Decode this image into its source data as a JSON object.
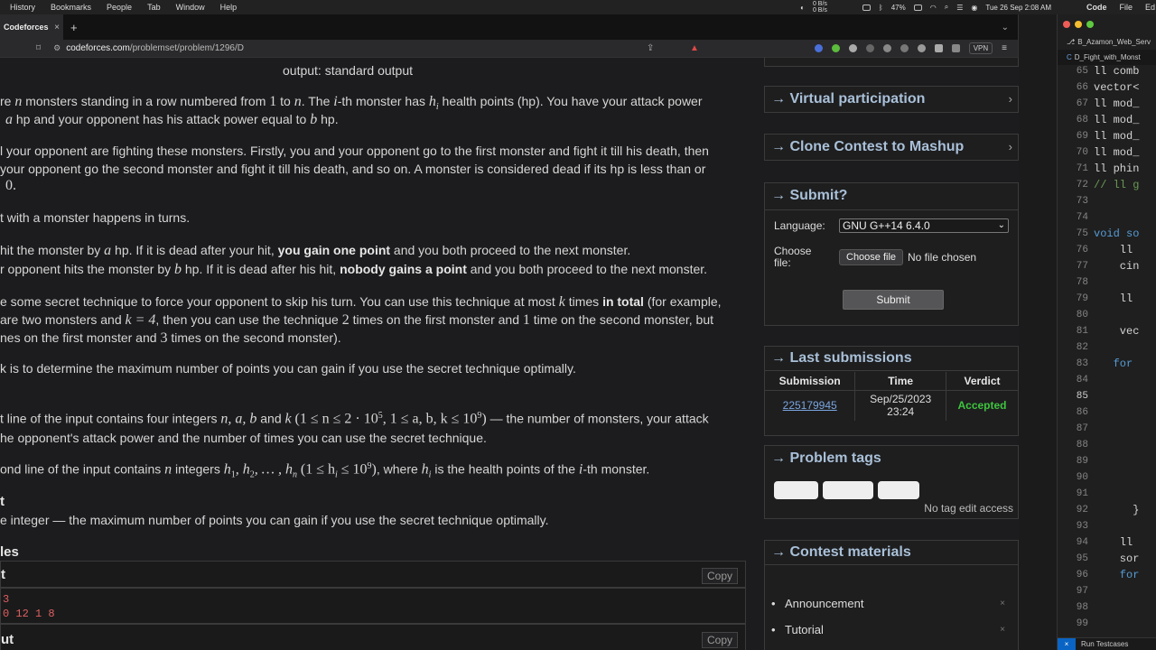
{
  "menubar": {
    "items": [
      "History",
      "Bookmarks",
      "People",
      "Tab",
      "Window",
      "Help"
    ],
    "net_up": "0 B/s",
    "net_down": "0 B/s",
    "battery": "47%",
    "datetime": "Tue 26 Sep  2:08 AM",
    "apps": [
      "Code",
      "File",
      "Ed"
    ]
  },
  "browser": {
    "tab_title": "Codeforces",
    "tab_close": "×",
    "new_tab": "+",
    "url_domain": "codeforces.com",
    "url_path": "/problemset/problem/1296/D",
    "vpn": "VPN"
  },
  "problem": {
    "output_line": "output: standard output",
    "p1a": "re ",
    "p1b": " monsters standing in a row numbered from ",
    "p1c": " to ",
    "p1d": ". The ",
    "p1e": "-th monster has ",
    "p1f": " health points (hp). You have your attack power",
    "p2a": " hp and your opponent has his attack power equal to ",
    "p2b": " hp.",
    "p3": "l your opponent are fighting these monsters. Firstly, you and your opponent go to the first monster and fight it till his death, then",
    "p4": " your opponent go the second monster and fight it till his death, and so on. A monster is considered dead if its hp is less than or",
    "p5": "0.",
    "p6": "t with a monster happens in turns.",
    "p7a": " hit the monster by ",
    "p7b": " hp. If it is dead after your hit, ",
    "p7c": "you gain one point",
    "p7d": " and you both proceed to the next monster.",
    "p8a": "r opponent hits the monster by ",
    "p8b": " hp. If it is dead after his hit, ",
    "p8c": "nobody gains a point",
    "p8d": " and you both proceed to the next monster.",
    "p9a": "e some secret technique to force your opponent to skip his turn. You can use this technique at most ",
    "p9b": " times ",
    "p9c": "in total",
    "p9d": " (for example,",
    "p10a": "are two monsters and ",
    "p10b": ", then you can use the technique ",
    "p10c": " times on the first monster and ",
    "p10d": " time on the second monster, but",
    "p11a": "nes on the first monster and ",
    "p11b": " times on the second monster).",
    "p12": "k is to determine the maximum number of points you can gain if you use the secret technique optimally.",
    "p13a": "t line of the input contains four integers ",
    "p13b": " and ",
    "p13c": " — the number of monsters, your attack",
    "p14": "he opponent's attack power and the number of times you can use the secret technique.",
    "p15a": "ond line of the input contains ",
    "p15b": " integers ",
    "p15c": ", where ",
    "p15d": " is the health points of the ",
    "p15e": "-th monster.",
    "output_header": "t",
    "p16": "e integer — the maximum number of points you can gain if you use the secret technique optimally.",
    "examples_header": "les",
    "input_label": "t",
    "copy1": "Copy",
    "sample_line1": "3",
    "sample_line2": "0 12 1 8",
    "output_label": "ut",
    "copy2": "Copy",
    "m_n": "n",
    "m_1": "1",
    "m_i": "i",
    "m_hi": "h",
    "m_hi_sub": "i",
    "m_a": "a",
    "m_b": "b",
    "m_0": "0",
    "m_k": "k",
    "m_k4": "k = 4",
    "m_2": "2",
    "m_3": "3",
    "m_nab": "n, a, b",
    "m_range1": "(1 ≤ n ≤ 2 · 10",
    "m_exp5": "5",
    "m_range2": ", 1 ≤ a, b, k ≤ 10",
    "m_exp9": "9",
    "m_close": ")",
    "m_hlist": "h",
    "m_hlist_tail": ", h",
    "m_hlist_dots": ", … , h",
    "m_sub1": "1",
    "m_sub2": "2",
    "m_subn": "n",
    "m_range3": "(1 ≤ h",
    "m_range3b": " ≤ 10",
    "m_range3c": ")"
  },
  "sidebar": {
    "virtual": "→ Virtual participation",
    "clone": "→ Clone Contest to Mashup",
    "submit_header": "→ Submit?",
    "language_label": "Language:",
    "language_value": "GNU G++14 6.4.0",
    "choose_label_1": "Choose",
    "choose_label_2": "file:",
    "choose_button": "Choose file",
    "no_file": "No file chosen",
    "submit_button": "Submit",
    "last_header": "→ Last submissions",
    "table_headers": [
      "Submission",
      "Time",
      "Verdict"
    ],
    "row": {
      "id": "225179945",
      "time1": "Sep/25/2023",
      "time2": "23:24",
      "verdict": "Accepted"
    },
    "tags_header": "→ Problem tags",
    "no_tag": "No tag edit access",
    "materials_header": "→ Contest materials",
    "materials": [
      "Announcement",
      "Tutorial"
    ],
    "mat_close": "×",
    "chevron": "›"
  },
  "editor": {
    "tab1": "B_Azamon_Web_Serv",
    "tab2": "D_Fight_with_Monst",
    "lines": [
      {
        "n": "65",
        "t": "ll comb"
      },
      {
        "n": "66",
        "t": "vector<"
      },
      {
        "n": "67",
        "t": "ll mod_"
      },
      {
        "n": "68",
        "t": "ll mod_"
      },
      {
        "n": "69",
        "t": "ll mod_"
      },
      {
        "n": "70",
        "t": "ll mod_"
      },
      {
        "n": "71",
        "t": "ll phin"
      },
      {
        "n": "72",
        "t": "// ll g"
      },
      {
        "n": "73",
        "t": ""
      },
      {
        "n": "74",
        "t": ""
      },
      {
        "n": "75",
        "t": "void so"
      },
      {
        "n": "76",
        "t": "    ll"
      },
      {
        "n": "77",
        "t": "    cin"
      },
      {
        "n": "78",
        "t": ""
      },
      {
        "n": "79",
        "t": "    ll"
      },
      {
        "n": "80",
        "t": ""
      },
      {
        "n": "81",
        "t": "    vec"
      },
      {
        "n": "82",
        "t": ""
      },
      {
        "n": "83",
        "t": "   for"
      },
      {
        "n": "84",
        "t": ""
      },
      {
        "n": "85",
        "t": ""
      },
      {
        "n": "86",
        "t": ""
      },
      {
        "n": "87",
        "t": ""
      },
      {
        "n": "88",
        "t": ""
      },
      {
        "n": "89",
        "t": ""
      },
      {
        "n": "90",
        "t": ""
      },
      {
        "n": "91",
        "t": ""
      },
      {
        "n": "92",
        "t": "      }"
      },
      {
        "n": "93",
        "t": ""
      },
      {
        "n": "94",
        "t": "    ll"
      },
      {
        "n": "95",
        "t": "    sor"
      },
      {
        "n": "96",
        "t": "    for"
      },
      {
        "n": "97",
        "t": ""
      },
      {
        "n": "98",
        "t": ""
      },
      {
        "n": "99",
        "t": ""
      }
    ],
    "status": "Run Testcases",
    "status_icon": "×"
  },
  "colors": {
    "accent": "#a9c0d8",
    "accepted": "#3ec43e",
    "link": "#7aa6e0"
  }
}
